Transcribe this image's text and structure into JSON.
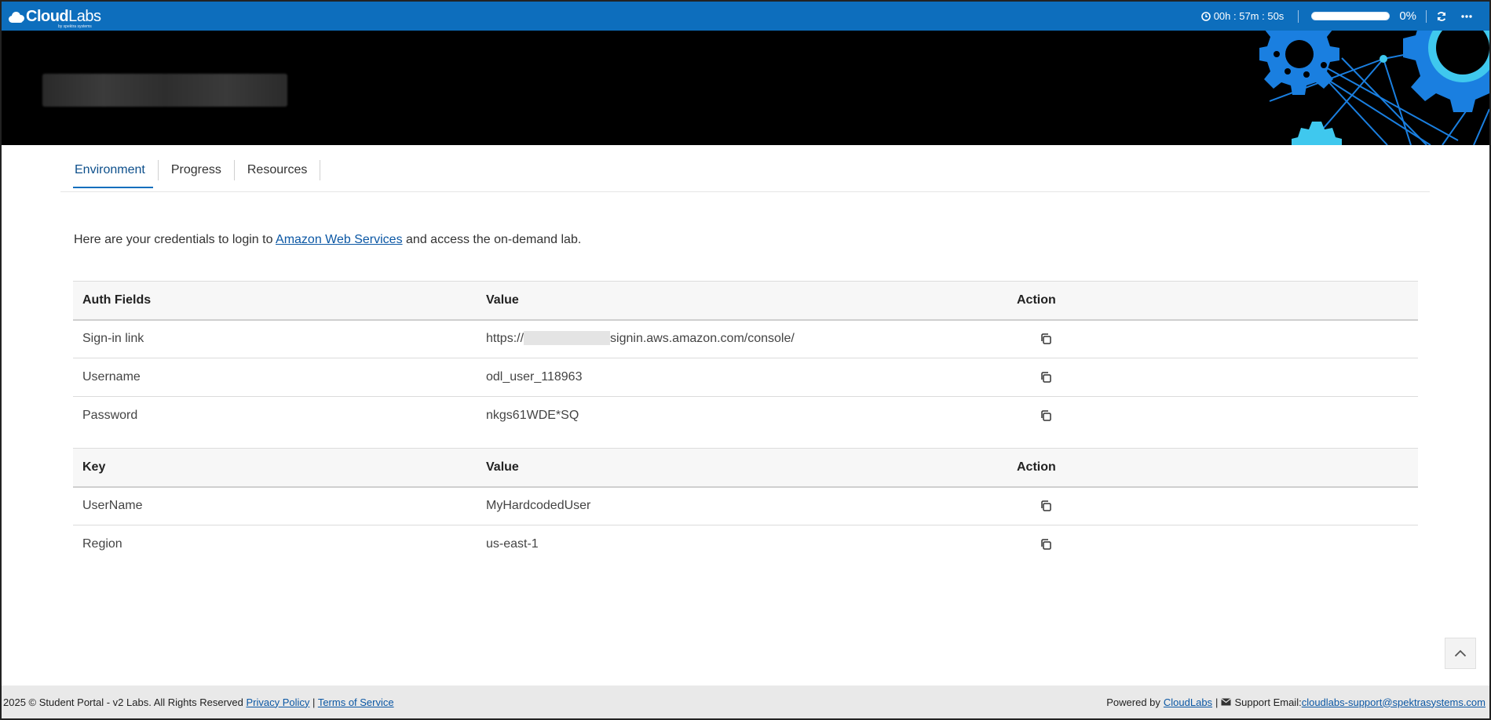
{
  "header": {
    "logo_text_bold": "Cloud",
    "logo_text_light": "Labs",
    "logo_subtext": "by spektra systems",
    "timer": "00h : 57m : 50s",
    "progress_percent": "0%",
    "progress_value": 0
  },
  "tabs": [
    {
      "label": "Environment"
    },
    {
      "label": "Progress"
    },
    {
      "label": "Resources"
    }
  ],
  "intro": {
    "before": "Here are your credentials to login to ",
    "link": "Amazon Web Services",
    "after": " and access the on-demand lab."
  },
  "auth_table": {
    "headers": [
      "Auth Fields",
      "Value",
      "Action"
    ],
    "rows": [
      {
        "field": "Sign-in link",
        "value_prefix": "https://",
        "value_suffix": "signin.aws.amazon.com/console/"
      },
      {
        "field": "Username",
        "value": "odl_user_118963"
      },
      {
        "field": "Password",
        "value": "nkgs61WDE*SQ"
      }
    ]
  },
  "key_table": {
    "headers": [
      "Key",
      "Value",
      "Action"
    ],
    "rows": [
      {
        "field": "UserName",
        "value": "MyHardcodedUser"
      },
      {
        "field": "Region",
        "value": "us-east-1"
      }
    ]
  },
  "footer": {
    "copyright": "2025 © Student Portal - v2 Labs. All Rights Reserved",
    "privacy": "Privacy Policy",
    "terms": "Terms of Service",
    "divider": "|",
    "powered_by": "Powered by",
    "powered_link": "CloudLabs",
    "support_label": "Support Email:",
    "support_email": "cloudlabs-support@spektrasystems.com"
  },
  "colors": {
    "brand_blue": "#0d6ebd",
    "link_blue": "#0b57a4",
    "banner_black": "#000000",
    "gear_blue": "#1a7fe0",
    "gear_cyan": "#3fc8ee"
  }
}
